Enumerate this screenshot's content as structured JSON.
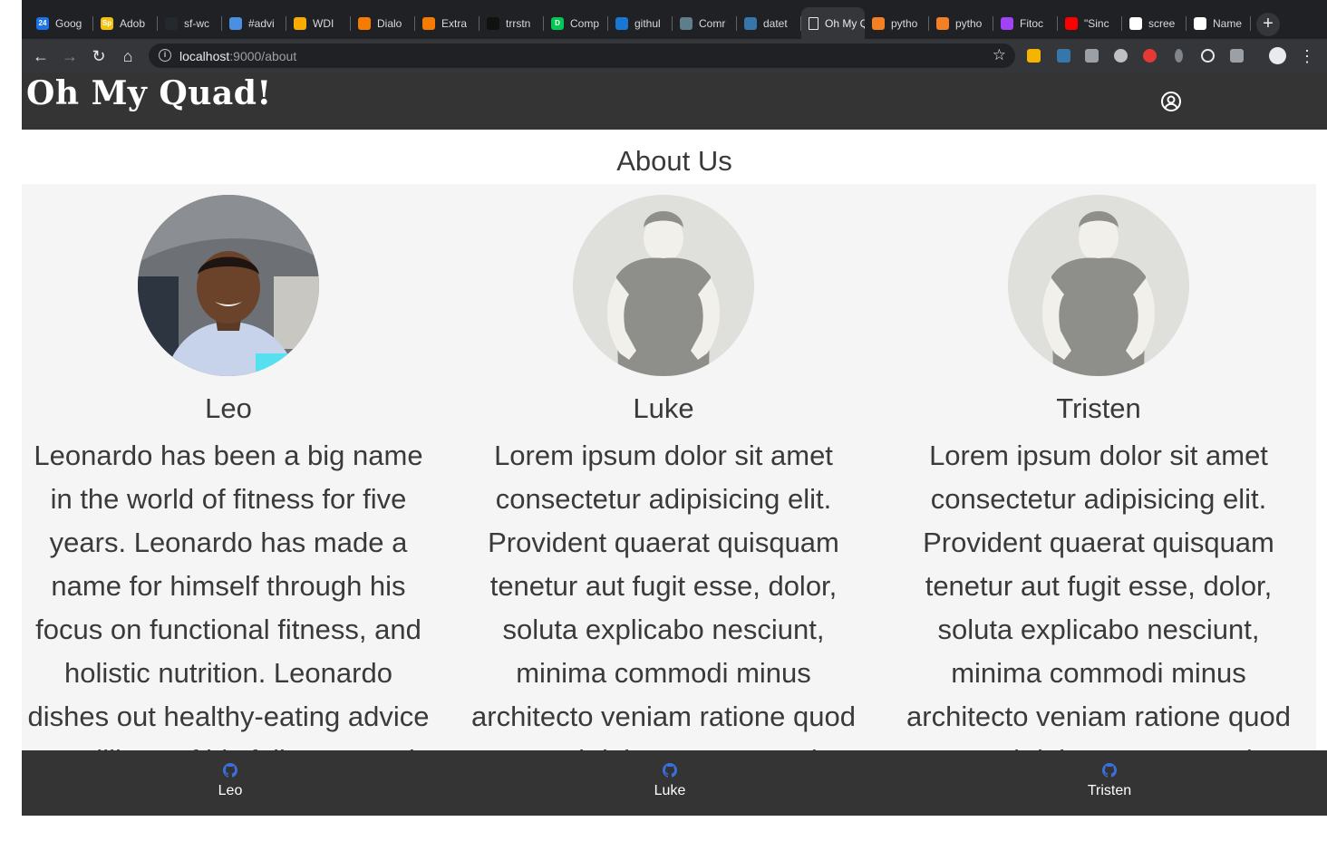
{
  "browser": {
    "tabs": [
      {
        "label": "Goog",
        "favicon": "calendar-icon",
        "color": "#1a73e8",
        "glyph": "24"
      },
      {
        "label": "Adob",
        "favicon": "adobe-spark-icon",
        "color": "#f4c20d",
        "glyph": "Sp"
      },
      {
        "label": "sf-wc",
        "favicon": "github-icon",
        "color": "#24292e",
        "glyph": ""
      },
      {
        "label": "#advi",
        "favicon": "slack-icon",
        "color": "#4a90e2",
        "glyph": ""
      },
      {
        "label": "WDI",
        "favicon": "slides-icon",
        "color": "#f9ab00",
        "glyph": ""
      },
      {
        "label": "Dialo",
        "favicon": "hex-icon",
        "color": "#f57c00",
        "glyph": ""
      },
      {
        "label": "Extra",
        "favicon": "hex-icon",
        "color": "#f57c00",
        "glyph": ""
      },
      {
        "label": "trrstn",
        "favicon": "dark-icon",
        "color": "#111111",
        "glyph": ""
      },
      {
        "label": "Comp",
        "favicon": "d-icon",
        "color": "#00c853",
        "glyph": "D"
      },
      {
        "label": "githul",
        "favicon": "flag-icon",
        "color": "#1976d2",
        "glyph": ""
      },
      {
        "label": "Comr",
        "favicon": "grid-icon",
        "color": "#607d8b",
        "glyph": ""
      },
      {
        "label": "datet",
        "favicon": "python-icon",
        "color": "#3776ab",
        "glyph": ""
      },
      {
        "label": "Oh My Quad!",
        "favicon": "page-icon",
        "color": "#e8eaed",
        "glyph": "",
        "active": true
      },
      {
        "label": "pytho",
        "favicon": "stackoverflow-icon",
        "color": "#f48024",
        "glyph": ""
      },
      {
        "label": "pytho",
        "favicon": "stackoverflow-icon",
        "color": "#f48024",
        "glyph": ""
      },
      {
        "label": "Fitoc",
        "favicon": "fitoc-icon",
        "color": "#a142f4",
        "glyph": ""
      },
      {
        "label": "\"Sinc",
        "favicon": "youtube-icon",
        "color": "#ff0000",
        "glyph": ""
      },
      {
        "label": "scree",
        "favicon": "google-icon",
        "color": "#ffffff",
        "glyph": ""
      },
      {
        "label": "Name",
        "favicon": "google-icon",
        "color": "#ffffff",
        "glyph": ""
      }
    ],
    "url_host": "localhost",
    "url_path": ":9000/about"
  },
  "header": {
    "brand": "Oh My Quad!",
    "profile_icon": "user-circle-icon"
  },
  "main": {
    "title": "About Us",
    "members": [
      {
        "name": "Leo",
        "photo": "photo",
        "bio": "Leonardo has been a big name in the world of fitness for five years. Leonardo has made a name for himself through his focus on functional fitness, and holistic nutrition. Leonardo dishes out healthy-eating advice to millions of his followers and outspoken and"
      },
      {
        "name": "Luke",
        "photo": "placeholder",
        "bio": "Lorem ipsum dolor sit amet consectetur adipisicing elit. Provident quaerat quisquam tenetur aut fugit esse, dolor, soluta explicabo nesciunt, minima commodi minus architecto veniam ratione quod excepturi dolorem tenetur vitae quibusdam"
      },
      {
        "name": "Tristen",
        "photo": "placeholder",
        "bio": "Lorem ipsum dolor sit amet consectetur adipisicing elit. Provident quaerat quisquam tenetur aut fugit esse, dolor, soluta explicabo nesciunt, minima commodi minus architecto veniam ratione quod excepturi dolorem tenetur vitae quibusdam"
      }
    ]
  },
  "footer": {
    "links": [
      {
        "label": "Leo",
        "icon": "github-icon"
      },
      {
        "label": "Luke",
        "icon": "github-icon"
      },
      {
        "label": "Tristen",
        "icon": "github-icon"
      }
    ],
    "icon_color": "#3b6fe0"
  }
}
